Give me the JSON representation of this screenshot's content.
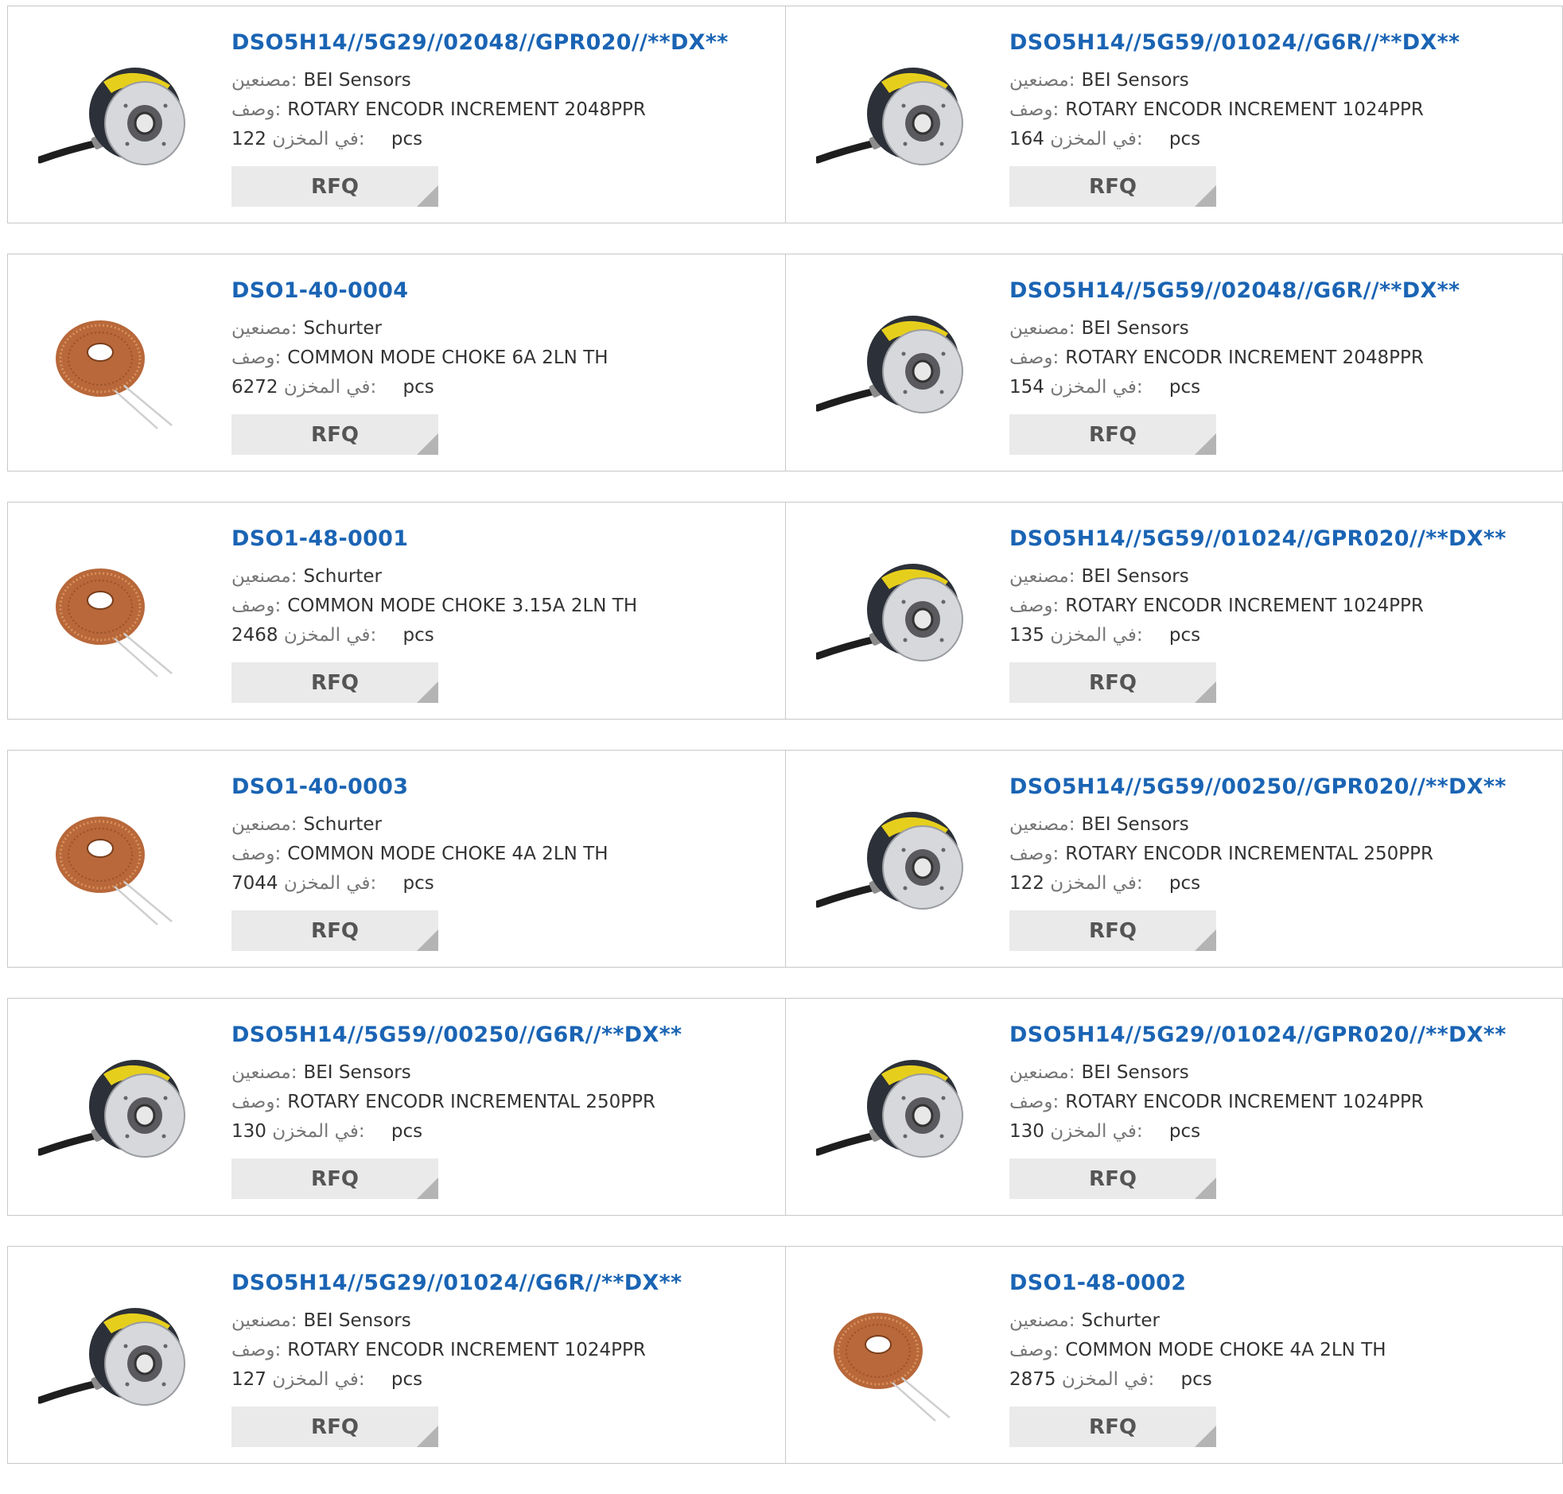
{
  "labels": {
    "manufacturer": "مصنعين:",
    "description": "وصف:",
    "in_stock": "في المخزن:",
    "unit": "pcs",
    "rfq": "RFQ"
  },
  "products": [
    {
      "part": "DSO5H14//5G29//02048//GPR020//**DX**",
      "manufacturer": "BEI Sensors",
      "description": "ROTARY ENCODR INCREMENT 2048PPR",
      "stock": "122",
      "image": "rotary-encoder"
    },
    {
      "part": "DSO5H14//5G59//01024//G6R//**DX**",
      "manufacturer": "BEI Sensors",
      "description": "ROTARY ENCODR INCREMENT 1024PPR",
      "stock": "164",
      "image": "rotary-encoder"
    },
    {
      "part": "DSO1-40-0004",
      "manufacturer": "Schurter",
      "description": "COMMON MODE CHOKE 6A 2LN TH",
      "stock": "6272",
      "image": "toroid-choke"
    },
    {
      "part": "DSO5H14//5G59//02048//G6R//**DX**",
      "manufacturer": "BEI Sensors",
      "description": "ROTARY ENCODR INCREMENT 2048PPR",
      "stock": "154",
      "image": "rotary-encoder"
    },
    {
      "part": "DSO1-48-0001",
      "manufacturer": "Schurter",
      "description": "COMMON MODE CHOKE 3.15A 2LN TH",
      "stock": "2468",
      "image": "toroid-choke"
    },
    {
      "part": "DSO5H14//5G59//01024//GPR020//**DX**",
      "manufacturer": "BEI Sensors",
      "description": "ROTARY ENCODR INCREMENT 1024PPR",
      "stock": "135",
      "image": "rotary-encoder"
    },
    {
      "part": "DSO1-40-0003",
      "manufacturer": "Schurter",
      "description": "COMMON MODE CHOKE 4A 2LN TH",
      "stock": "7044",
      "image": "toroid-choke"
    },
    {
      "part": "DSO5H14//5G59//00250//GPR020//**DX**",
      "manufacturer": "BEI Sensors",
      "description": "ROTARY ENCODR INCREMENTAL 250PPR",
      "stock": "122",
      "image": "rotary-encoder"
    },
    {
      "part": "DSO5H14//5G59//00250//G6R//**DX**",
      "manufacturer": "BEI Sensors",
      "description": "ROTARY ENCODR INCREMENTAL 250PPR",
      "stock": "130",
      "image": "rotary-encoder"
    },
    {
      "part": "DSO5H14//5G29//01024//GPR020//**DX**",
      "manufacturer": "BEI Sensors",
      "description": "ROTARY ENCODR INCREMENT 1024PPR",
      "stock": "130",
      "image": "rotary-encoder"
    },
    {
      "part": "DSO5H14//5G29//01024//G6R//**DX**",
      "manufacturer": "BEI Sensors",
      "description": "ROTARY ENCODR INCREMENT 1024PPR",
      "stock": "127",
      "image": "rotary-encoder"
    },
    {
      "part": "DSO1-48-0002",
      "manufacturer": "Schurter",
      "description": "COMMON MODE CHOKE 4A 2LN TH",
      "stock": "2875",
      "image": "toroid-choke"
    }
  ]
}
